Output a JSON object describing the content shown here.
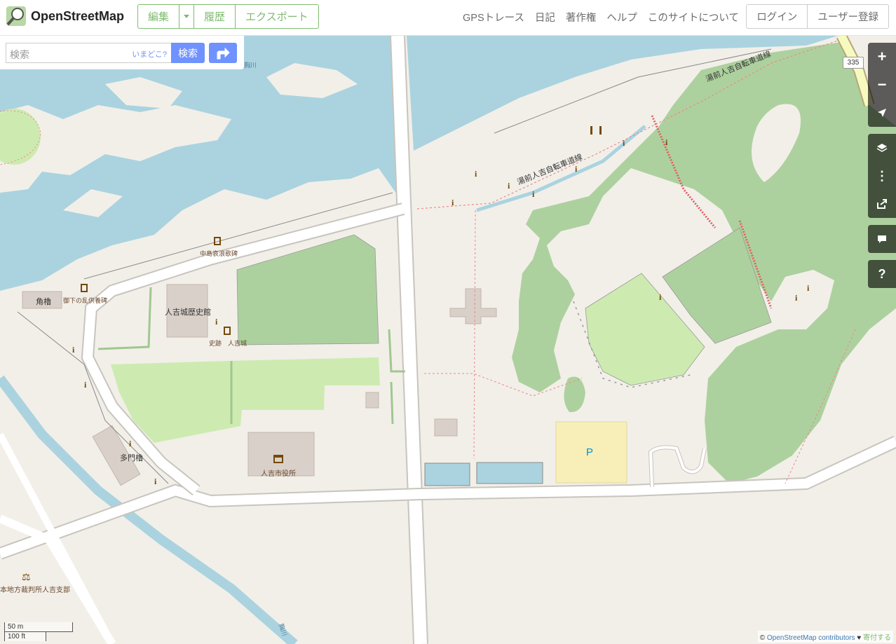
{
  "header": {
    "logo_text": "OpenStreetMap",
    "edit_label": "編集",
    "history_label": "履歴",
    "export_label": "エクスポート",
    "nav": [
      "GPSトレース",
      "日記",
      "著作権",
      "ヘルプ",
      "このサイトについて"
    ],
    "login_label": "ログイン",
    "signup_label": "ユーザー登録"
  },
  "search": {
    "placeholder": "検索",
    "where_am_i": "いまどこ?",
    "button_label": "検索"
  },
  "map": {
    "labels": {
      "history_museum": "人吉城歴史館",
      "city_hall": "人吉市役所",
      "tamon_yagura": "多門櫓",
      "sumi_yagura": "角櫓",
      "court": "本地方裁判所人吉支部",
      "monument1": "中島哀浪歌碑",
      "monument2": "御下の乱供養碑",
      "castle_site": "史跡　人吉城",
      "cycle_road1": "湯前人吉自転車道線",
      "cycle_road2": "湯前人吉自転車道線",
      "route_number": "335",
      "parking": "P",
      "river_small": "胸川",
      "river_top": "胸川"
    }
  },
  "scale": {
    "metric": "50 m",
    "imperial": "100 ft"
  },
  "attribution": {
    "prefix": "©",
    "link": "OpenStreetMap contributors",
    "heart": "♥",
    "donate": "寄付する"
  },
  "colors": {
    "brand_green": "#7ebc6f",
    "search_blue": "#7092ff",
    "water": "#aad3df",
    "forest": "#add19e",
    "grass": "#cdebb0",
    "land": "#f2efe9",
    "parking": "#f7efb7"
  }
}
